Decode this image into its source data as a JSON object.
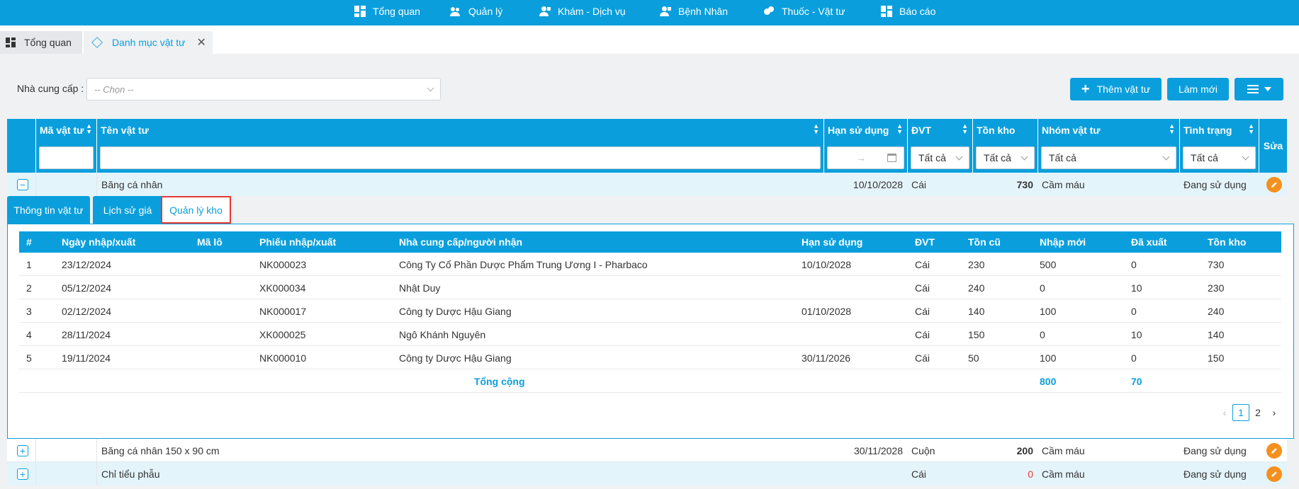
{
  "topnav": {
    "items": [
      {
        "label": "Tổng quan",
        "icon": "dashboard-icon"
      },
      {
        "label": "Quản lý",
        "icon": "users-icon"
      },
      {
        "label": "Khám - Dịch vụ",
        "icon": "doctor-icon"
      },
      {
        "label": "Bệnh Nhân",
        "icon": "patient-icon"
      },
      {
        "label": "Thuốc - Vật tư",
        "icon": "pills-icon"
      },
      {
        "label": "Báo cáo",
        "icon": "report-icon"
      }
    ]
  },
  "tabs": {
    "home": "Tổng quan",
    "current": "Danh mục vật tư"
  },
  "filter": {
    "supplier_label": "Nhà cung cấp :",
    "supplier_placeholder": "-- Chọn --"
  },
  "toolbar": {
    "add_label": "Thêm vật tư",
    "refresh_label": "Làm mới"
  },
  "table": {
    "headers": {
      "code": "Mã vật tư",
      "name": "Tên vật tư",
      "expiry": "Hạn sử dụng",
      "unit": "ĐVT",
      "stock": "Tồn kho",
      "group": "Nhóm vật tư",
      "status": "Tình trạng",
      "edit": "Sửa"
    },
    "filters": {
      "unit": "Tất cả",
      "stock": "Tất cả",
      "group": "Tất cả",
      "status": "Tất cả",
      "date_sep": "→"
    },
    "rows": [
      {
        "name": "Băng cá nhân",
        "expiry": "10/10/2028",
        "unit": "Cái",
        "stock": "730",
        "group": "Cầm máu",
        "status": "Đang sử dụng"
      },
      {
        "name": "Băng cá nhân 150 x 90 cm",
        "expiry": "30/11/2028",
        "unit": "Cuộn",
        "stock": "200",
        "group": "Cầm máu",
        "status": "Đang sử dụng"
      },
      {
        "name": "Chỉ tiểu phẫu",
        "expiry": "",
        "unit": "Cái",
        "stock": "0",
        "group": "Cầm máu",
        "status": "Đang sử dụng"
      }
    ]
  },
  "detail": {
    "tabs": [
      "Thông tin vật tư",
      "Lịch sử giá",
      "Quản lý kho"
    ],
    "headers": [
      "#",
      "Ngày nhập/xuất",
      "Mã lô",
      "Phiếu nhập/xuất",
      "Nhà cung cấp/người nhận",
      "Hạn sử dụng",
      "ĐVT",
      "Tồn cũ",
      "Nhập mới",
      "Đã xuất",
      "Tồn kho"
    ],
    "rows": [
      [
        "1",
        "23/12/2024",
        "",
        "NK000023",
        "Công Ty Cổ Phần Dược Phẩm Trung Ương I - Pharbaco",
        "10/10/2028",
        "Cái",
        "230",
        "500",
        "0",
        "730"
      ],
      [
        "2",
        "05/12/2024",
        "",
        "XK000034",
        "Nhật Duy",
        "",
        "Cái",
        "240",
        "0",
        "10",
        "230"
      ],
      [
        "3",
        "02/12/2024",
        "",
        "NK000017",
        "Công ty Dược Hậu Giang",
        "01/10/2028",
        "Cái",
        "140",
        "100",
        "0",
        "240"
      ],
      [
        "4",
        "28/11/2024",
        "",
        "XK000025",
        "Ngô Khánh Nguyên",
        "",
        "Cái",
        "150",
        "0",
        "10",
        "140"
      ],
      [
        "5",
        "19/11/2024",
        "",
        "NK000010",
        "Công ty Dược Hậu Giang",
        "30/11/2026",
        "Cái",
        "50",
        "100",
        "0",
        "150"
      ]
    ],
    "total": {
      "label": "Tổng cộng",
      "import": "800",
      "export": "70"
    },
    "pager": {
      "pages": [
        "1",
        "2"
      ],
      "current": "1"
    }
  },
  "colors": {
    "primary": "#0a9fdc",
    "edit": "#f5901e",
    "highlight": "#e53935"
  }
}
